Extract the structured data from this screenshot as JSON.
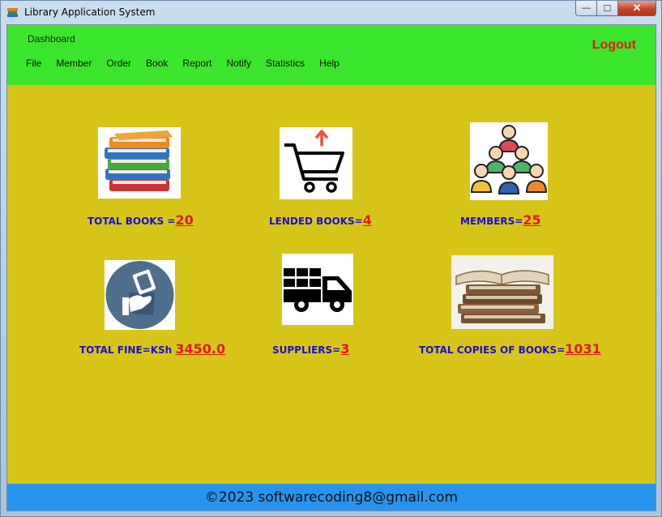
{
  "window": {
    "title": "Library Application System",
    "minimize": "—",
    "maximize": "☐",
    "close": "✕"
  },
  "menubar": {
    "dashboard": "Dashboard",
    "items": [
      "File",
      "Member",
      "Order",
      "Book",
      "Report",
      "Notify",
      "Statistics",
      "Help"
    ],
    "logout": "Logout"
  },
  "stats": [
    {
      "label": "TOTAL BOOKS =",
      "value": "20",
      "icon": "books-stack-icon"
    },
    {
      "label": "LENDED BOOKS=",
      "value": "4",
      "icon": "shopping-cart-icon"
    },
    {
      "label": "MEMBERS=",
      "value": "25",
      "icon": "people-group-icon"
    },
    {
      "label": "TOTAL  FINE=KSh ",
      "value": "3450.0",
      "icon": "money-hand-icon"
    },
    {
      "label": "SUPPLIERS=",
      "value": "3",
      "icon": "delivery-truck-icon"
    },
    {
      "label": "TOTAL COPIES OF  BOOKS=",
      "value": "1031",
      "icon": "old-books-icon"
    }
  ],
  "footer": {
    "text": "©2023 softwarecoding8@gmail.com"
  },
  "colors": {
    "menubar": "#3ae52c",
    "content": "#d8c51a",
    "footer": "#2893ee",
    "label": "#1810c8",
    "value": "#e01c1c"
  }
}
